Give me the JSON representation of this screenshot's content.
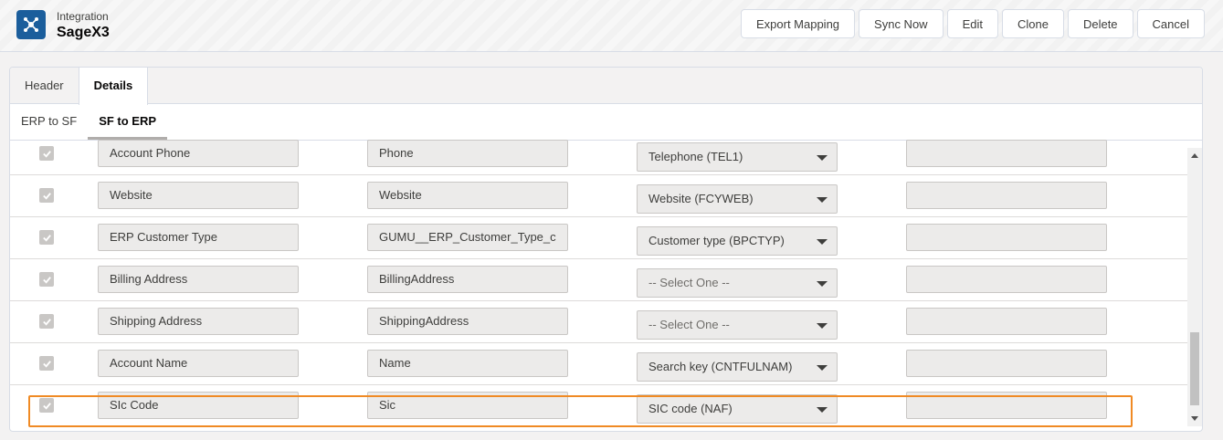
{
  "header": {
    "object_label": "Integration",
    "record_name": "SageX3",
    "icon": "integration-network-icon",
    "buttons": [
      "Export Mapping",
      "Sync Now",
      "Edit",
      "Clone",
      "Delete",
      "Cancel"
    ]
  },
  "tabs": {
    "main": [
      {
        "label": "Header",
        "active": false
      },
      {
        "label": "Details",
        "active": true
      }
    ],
    "sub": [
      {
        "label": "ERP to SF",
        "active": false
      },
      {
        "label": "SF to ERP",
        "active": true
      }
    ]
  },
  "rows": [
    {
      "checked": true,
      "sf_label": "Account Phone",
      "sf_field": "Phone",
      "erp_field": "Telephone (TEL1)",
      "default_value": ""
    },
    {
      "checked": true,
      "sf_label": "Website",
      "sf_field": "Website",
      "erp_field": "Website (FCYWEB)",
      "default_value": ""
    },
    {
      "checked": true,
      "sf_label": "ERP Customer Type",
      "sf_field": "GUMU__ERP_Customer_Type_c",
      "erp_field": "Customer type (BPCTYP)",
      "default_value": ""
    },
    {
      "checked": true,
      "sf_label": "Billing Address",
      "sf_field": "BillingAddress",
      "erp_field": "-- Select One --",
      "default_value": ""
    },
    {
      "checked": true,
      "sf_label": "Shipping Address",
      "sf_field": "ShippingAddress",
      "erp_field": "-- Select One --",
      "default_value": ""
    },
    {
      "checked": true,
      "sf_label": "Account Name",
      "sf_field": "Name",
      "erp_field": "Search key (CNTFULNAM)",
      "default_value": ""
    },
    {
      "checked": true,
      "sf_label": "SIc Code",
      "sf_field": "Sic",
      "erp_field": "SIC code (NAF)",
      "default_value": ""
    }
  ],
  "colors": {
    "highlight": "#f08a24",
    "brand": "#1b5e9c"
  }
}
